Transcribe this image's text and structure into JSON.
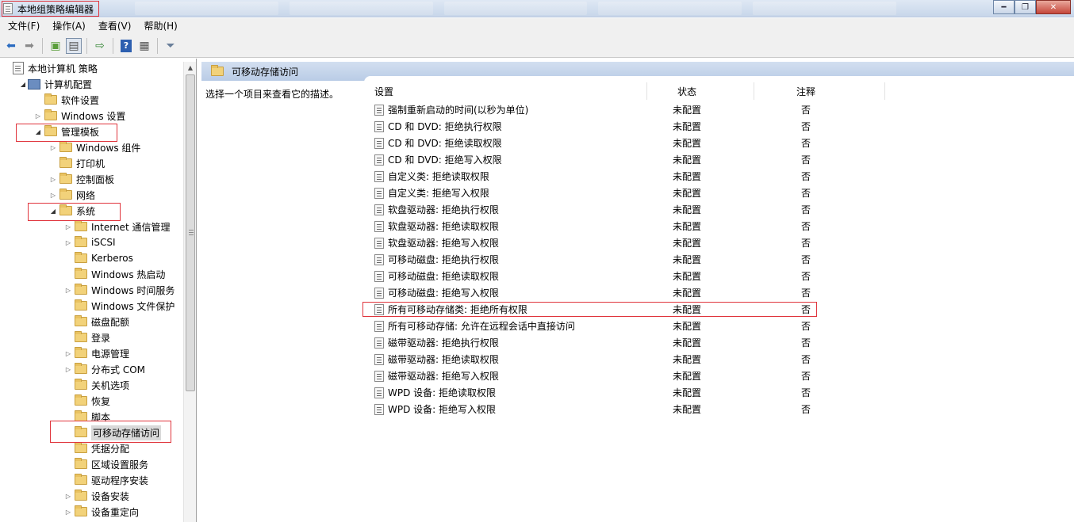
{
  "window": {
    "title": "本地组策略编辑器"
  },
  "menu": [
    {
      "label": "文件(F)"
    },
    {
      "label": "操作(A)"
    },
    {
      "label": "查看(V)"
    },
    {
      "label": "帮助(H)"
    }
  ],
  "toolbar": [
    "back-icon",
    "forward-icon",
    "up-folder-icon",
    "show-hide-tree-icon",
    "export-list-icon",
    "help-icon",
    "properties-icon",
    "filter-icon"
  ],
  "tree": [
    {
      "label": "本地计算机 策略",
      "depth": 0,
      "icon": "doc",
      "arrow": ""
    },
    {
      "label": "计算机配置",
      "depth": 1,
      "icon": "pc",
      "arrow": "open"
    },
    {
      "label": "软件设置",
      "depth": 2,
      "icon": "folder",
      "arrow": ""
    },
    {
      "label": "Windows 设置",
      "depth": 2,
      "icon": "folder",
      "arrow": "closed"
    },
    {
      "label": "管理模板",
      "depth": 2,
      "icon": "folder",
      "arrow": "open"
    },
    {
      "label": "Windows 组件",
      "depth": 3,
      "icon": "folder",
      "arrow": "closed"
    },
    {
      "label": "打印机",
      "depth": 3,
      "icon": "folder",
      "arrow": ""
    },
    {
      "label": "控制面板",
      "depth": 3,
      "icon": "folder",
      "arrow": "closed"
    },
    {
      "label": "网络",
      "depth": 3,
      "icon": "folder",
      "arrow": "closed"
    },
    {
      "label": "系统",
      "depth": 3,
      "icon": "folder",
      "arrow": "open"
    },
    {
      "label": "Internet 通信管理",
      "depth": 4,
      "icon": "folder",
      "arrow": "closed"
    },
    {
      "label": "iSCSI",
      "depth": 4,
      "icon": "folder",
      "arrow": "closed"
    },
    {
      "label": "Kerberos",
      "depth": 4,
      "icon": "folder",
      "arrow": ""
    },
    {
      "label": "Windows 热启动",
      "depth": 4,
      "icon": "folder",
      "arrow": ""
    },
    {
      "label": "Windows 时间服务",
      "depth": 4,
      "icon": "folder",
      "arrow": "closed"
    },
    {
      "label": "Windows 文件保护",
      "depth": 4,
      "icon": "folder",
      "arrow": ""
    },
    {
      "label": "磁盘配额",
      "depth": 4,
      "icon": "folder",
      "arrow": ""
    },
    {
      "label": "登录",
      "depth": 4,
      "icon": "folder",
      "arrow": ""
    },
    {
      "label": "电源管理",
      "depth": 4,
      "icon": "folder",
      "arrow": "closed"
    },
    {
      "label": "分布式 COM",
      "depth": 4,
      "icon": "folder",
      "arrow": "closed"
    },
    {
      "label": "关机选项",
      "depth": 4,
      "icon": "folder",
      "arrow": ""
    },
    {
      "label": "恢复",
      "depth": 4,
      "icon": "folder",
      "arrow": ""
    },
    {
      "label": "脚本",
      "depth": 4,
      "icon": "folder",
      "arrow": ""
    },
    {
      "label": "可移动存储访问",
      "depth": 4,
      "icon": "folder",
      "arrow": "",
      "selected": true
    },
    {
      "label": "凭据分配",
      "depth": 4,
      "icon": "folder",
      "arrow": ""
    },
    {
      "label": "区域设置服务",
      "depth": 4,
      "icon": "folder",
      "arrow": ""
    },
    {
      "label": "驱动程序安装",
      "depth": 4,
      "icon": "folder",
      "arrow": ""
    },
    {
      "label": "设备安装",
      "depth": 4,
      "icon": "folder",
      "arrow": "closed"
    },
    {
      "label": "设备重定向",
      "depth": 4,
      "icon": "folder",
      "arrow": "closed"
    }
  ],
  "right": {
    "header": "可移动存储访问",
    "description": "选择一个项目来查看它的描述。",
    "columns": {
      "setting": "设置",
      "state": "状态",
      "note": "注释"
    },
    "rows": [
      {
        "name": "强制重新启动的时间(以秒为单位)",
        "state": "未配置",
        "note": "否"
      },
      {
        "name": "CD 和 DVD: 拒绝执行权限",
        "state": "未配置",
        "note": "否"
      },
      {
        "name": "CD 和 DVD: 拒绝读取权限",
        "state": "未配置",
        "note": "否"
      },
      {
        "name": "CD 和 DVD: 拒绝写入权限",
        "state": "未配置",
        "note": "否"
      },
      {
        "name": "自定义类: 拒绝读取权限",
        "state": "未配置",
        "note": "否"
      },
      {
        "name": "自定义类: 拒绝写入权限",
        "state": "未配置",
        "note": "否"
      },
      {
        "name": "软盘驱动器: 拒绝执行权限",
        "state": "未配置",
        "note": "否"
      },
      {
        "name": "软盘驱动器: 拒绝读取权限",
        "state": "未配置",
        "note": "否"
      },
      {
        "name": "软盘驱动器: 拒绝写入权限",
        "state": "未配置",
        "note": "否"
      },
      {
        "name": "可移动磁盘: 拒绝执行权限",
        "state": "未配置",
        "note": "否"
      },
      {
        "name": "可移动磁盘: 拒绝读取权限",
        "state": "未配置",
        "note": "否"
      },
      {
        "name": "可移动磁盘: 拒绝写入权限",
        "state": "未配置",
        "note": "否"
      },
      {
        "name": "所有可移动存储类: 拒绝所有权限",
        "state": "未配置",
        "note": "否",
        "highlight": true
      },
      {
        "name": "所有可移动存储: 允许在远程会话中直接访问",
        "state": "未配置",
        "note": "否"
      },
      {
        "name": "磁带驱动器: 拒绝执行权限",
        "state": "未配置",
        "note": "否"
      },
      {
        "name": "磁带驱动器: 拒绝读取权限",
        "state": "未配置",
        "note": "否"
      },
      {
        "name": "磁带驱动器: 拒绝写入权限",
        "state": "未配置",
        "note": "否"
      },
      {
        "name": "WPD 设备: 拒绝读取权限",
        "state": "未配置",
        "note": "否"
      },
      {
        "name": "WPD 设备: 拒绝写入权限",
        "state": "未配置",
        "note": "否"
      }
    ]
  },
  "colors": {
    "highlight_border": "#e0343c",
    "header_blue": "#c5d6ec"
  }
}
